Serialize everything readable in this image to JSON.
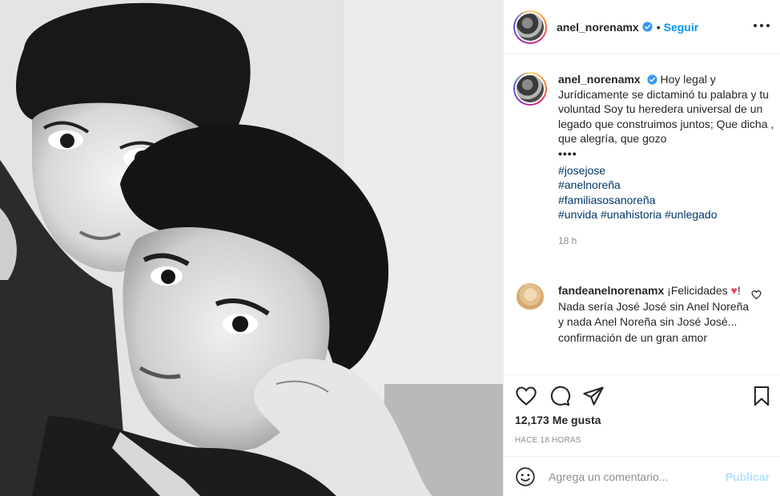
{
  "post": {
    "username": "anel_norenamx",
    "verified": true,
    "follow_label": "Seguir",
    "separator": "•",
    "photo_description_icon": "photo",
    "caption": {
      "username": "anel_norenamx",
      "text": "Hoy legal y Jurídicamente se dictaminó tu palabra y tu voluntad Soy tu heredera universal de un legado que construimos juntos; Que dicha , que alegría, que gozo",
      "dots": "••••",
      "hashtags_block": [
        "#josejose",
        "#anelnoreña",
        "#familiasosanoreña"
      ],
      "hashtags_inline": [
        "#unvida",
        "#unahistoria",
        "#unlegado"
      ],
      "time": "18 h"
    },
    "comment": {
      "username": "fandeanelnorenamx",
      "text_before_heart": "¡Felicidades",
      "heart": "♥",
      "text_after_heart": "! Nada sería José José sin Anel Noreña y nada Anel Noreña sin José José... confirmación de un gran amor"
    },
    "likes": "12,173 Me gusta",
    "time_ago": "HACE 18 HORAS",
    "comment_placeholder": "Agrega un comentario...",
    "publish_label": "Publicar"
  },
  "colors": {
    "link": "#0095f6",
    "hashtag": "#00376b",
    "muted": "#8e8e8e",
    "heart": "#ed4956",
    "publish_disabled": "#b2dffc"
  },
  "icons": [
    "more-icon",
    "verified-icon",
    "heart-icon",
    "comment-icon",
    "share-icon",
    "save-icon",
    "emoji-icon",
    "comment-like-icon"
  ]
}
